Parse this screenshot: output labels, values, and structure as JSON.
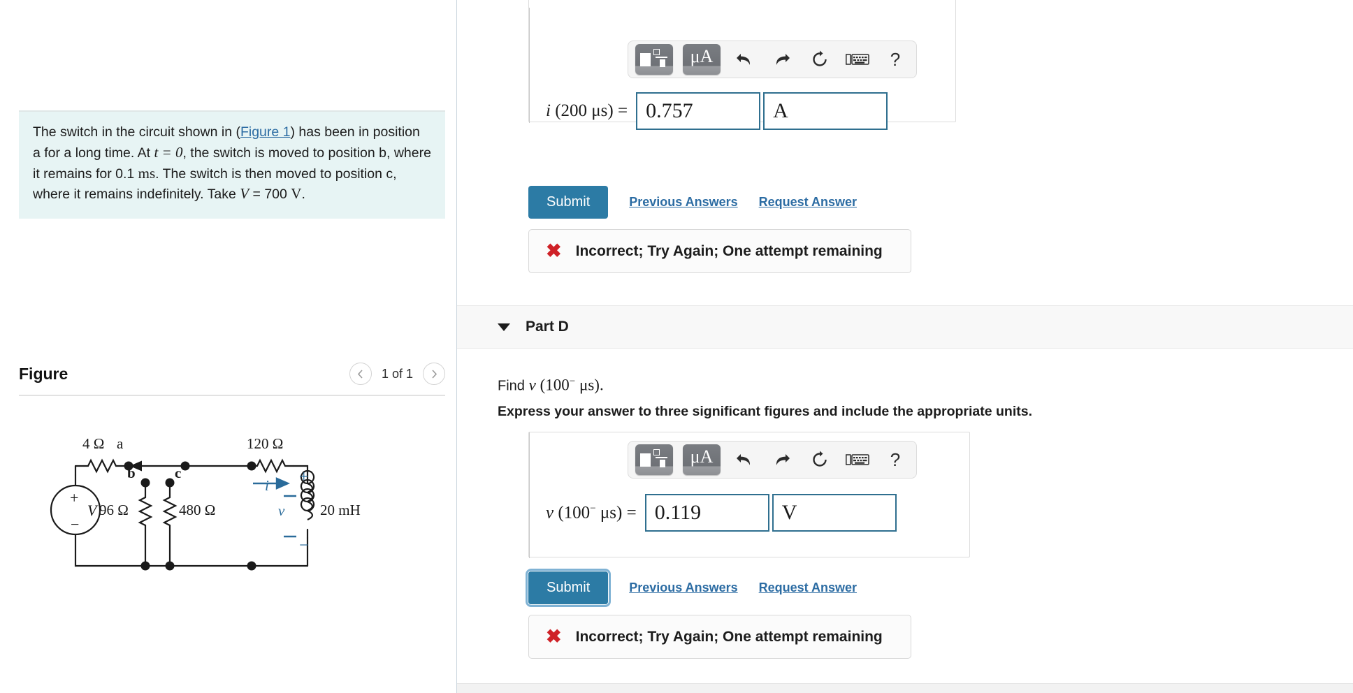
{
  "problem": {
    "text_1": "The switch in the circuit shown in (",
    "figure_link": "Figure 1",
    "text_2": ") has been in position a for a long time. At ",
    "math_t": "t = 0",
    "text_3": ", the switch is moved to position b, where it remains for 0.1 ",
    "unit_ms": "ms",
    "text_4": ". The switch is then moved to position c, where it remains indefinitely. Take ",
    "math_V": "V",
    "text_5": " = 700 ",
    "unit_V": "V",
    "text_6": "."
  },
  "figure": {
    "title": "Figure",
    "prev_icon": "chevron-left-icon",
    "next_icon": "chevron-right-icon",
    "counter": "1 of 1",
    "circuit": {
      "r_source": "4 Ω",
      "node_a": "a",
      "node_b": "b",
      "node_c": "c",
      "r_96": "96 Ω",
      "r_480": "480 Ω",
      "r_120": "120 Ω",
      "inductor": "20 mH",
      "source_label": "V",
      "source_plus": "+",
      "source_minus": "−",
      "current_label": "i",
      "voltage_label": "v",
      "v_plus": "+",
      "v_minus": "−"
    }
  },
  "toolbar": {
    "template_icon": "math-template-icon",
    "units_label": "μA",
    "undo_icon": "undo-icon",
    "redo_icon": "redo-icon",
    "reset_icon": "reset-icon",
    "keyboard_icon": "keyboard-icon",
    "help_label": "?"
  },
  "part_c": {
    "eq_var": "i",
    "eq_arg": "(200 μs)",
    "eq_eq": "=",
    "answer_value": "0.757",
    "answer_units": "A",
    "submit_label": "Submit",
    "previous_answers_label": "Previous Answers",
    "request_answer_label": "Request Answer",
    "feedback_icon": "x-mark-icon",
    "feedback_text": "Incorrect; Try Again; One attempt remaining"
  },
  "part_d": {
    "caret_icon": "caret-down-icon",
    "title": "Part D",
    "question_find": "Find",
    "question_var": "v",
    "question_arg_open": "(100",
    "question_sup": "−",
    "question_arg_close": " μs).",
    "instruction": "Express your answer to three significant figures and include the appropriate units.",
    "eq_var": "v",
    "eq_arg_open": "(100",
    "eq_sup": "−",
    "eq_arg_close": " μs)",
    "eq_eq": "=",
    "answer_value": "0.119",
    "answer_units": "V",
    "submit_label": "Submit",
    "previous_answers_label": "Previous Answers",
    "request_answer_label": "Request Answer",
    "feedback_icon": "x-mark-icon",
    "feedback_text": "Incorrect; Try Again; One attempt remaining"
  },
  "colors": {
    "accent": "#2c7ba5",
    "link": "#2c6ca3",
    "error": "#cf2127",
    "problem_bg": "#e7f4f4",
    "input_border": "#2f6f8f"
  }
}
